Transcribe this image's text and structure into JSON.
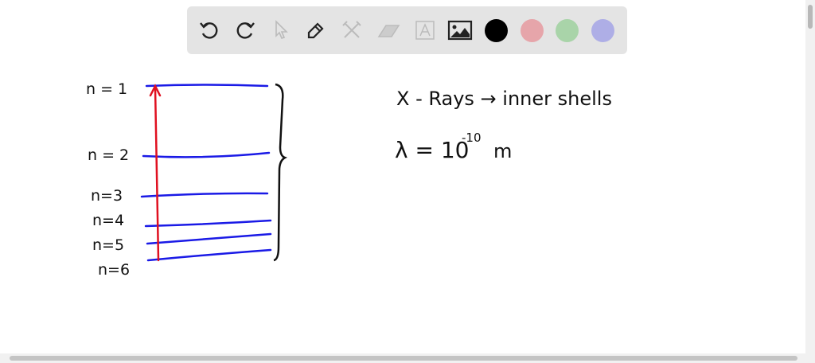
{
  "toolbar": {
    "tools": [
      "undo-icon",
      "redo-icon",
      "select-icon",
      "pen-icon",
      "tools-icon",
      "eraser-icon",
      "text-icon",
      "image-icon"
    ],
    "colors": [
      "#000000",
      "#e6a5aa",
      "#a9d4a9",
      "#aeaee6"
    ]
  },
  "board": {
    "levels": [
      "n = 1",
      "n = 2",
      "n=3",
      "n=4",
      "n=5",
      "n=6"
    ],
    "note_line1": "X - Rays → inner shells",
    "note_lambda": "λ = 10",
    "note_exp": "-10",
    "note_unit": "m",
    "level_color": "#1a1ae6",
    "arrow_color": "#e01020"
  }
}
